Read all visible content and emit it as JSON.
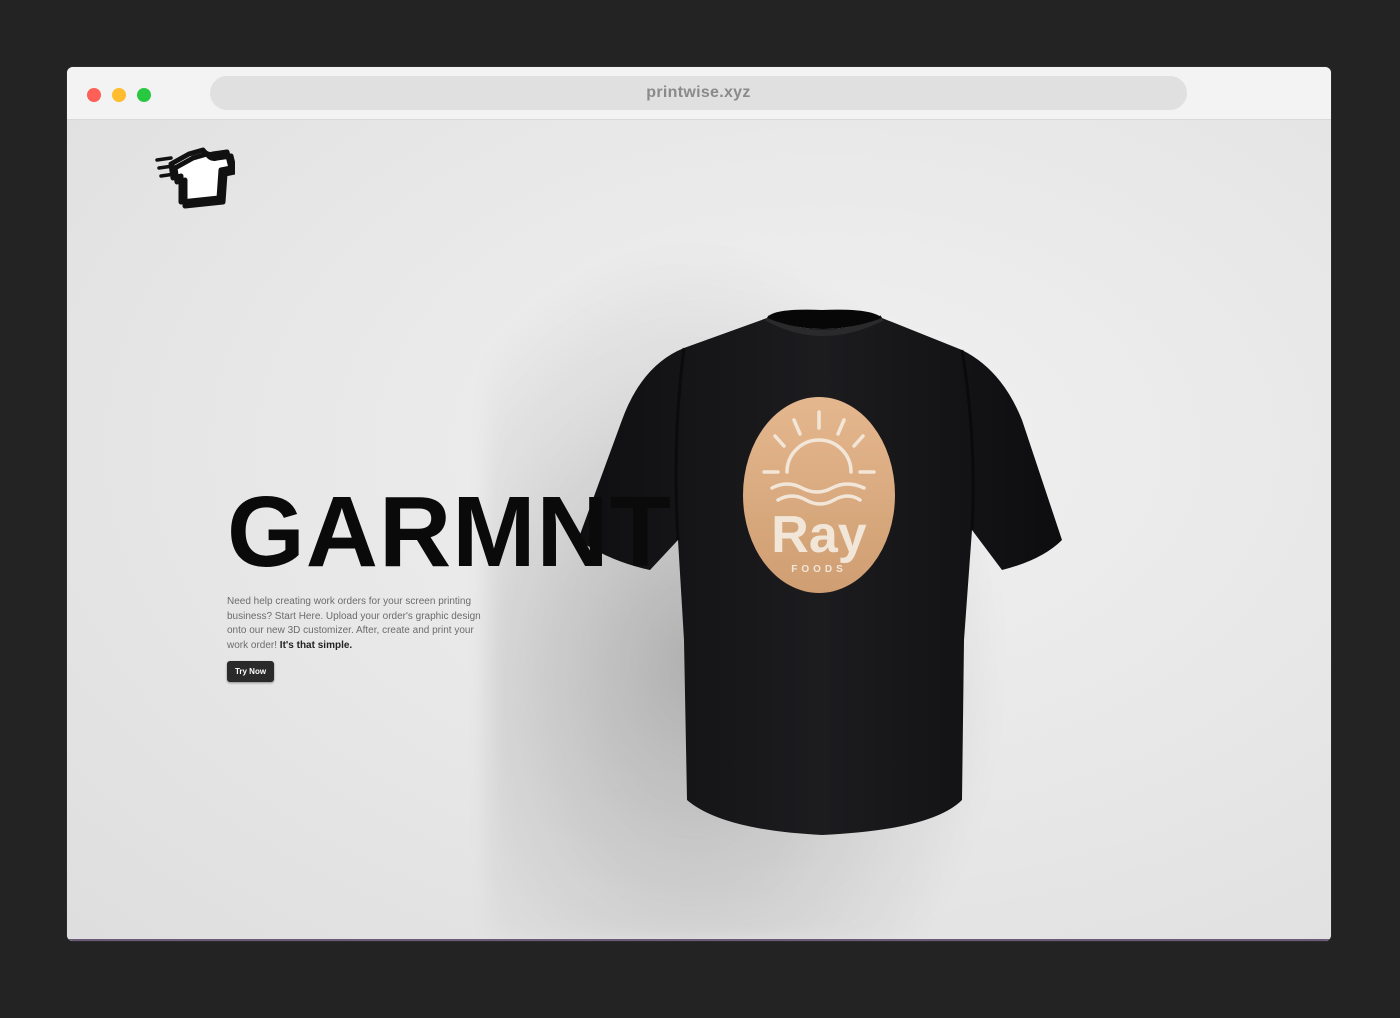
{
  "browser": {
    "url": "printwise.xyz"
  },
  "hero": {
    "title": "GARMNT",
    "description": "Need help creating work orders for your screen printing business? Start Here. Upload your order's graphic design onto our new 3D customizer. After, create and print your work order! ",
    "description_emphasis": "It's that simple.",
    "cta_label": "Try Now"
  },
  "shirt_graphic": {
    "brand": "Ray",
    "subtitle": "FOODS",
    "badge_color": "#d9a87c",
    "shirt_color": "#141416"
  },
  "icons": {
    "logo": "tshirt-speed-logo-icon"
  }
}
